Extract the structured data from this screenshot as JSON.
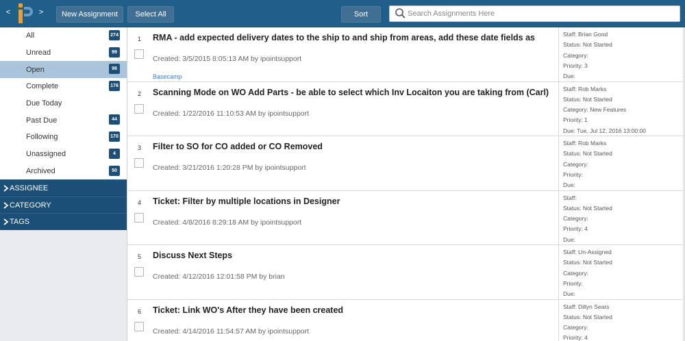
{
  "toolbar": {
    "back": "<",
    "forward": ">",
    "new_assignment": "New Assignment",
    "select_all": "Select All",
    "sort": "Sort",
    "search_placeholder": "Search Assignments Here"
  },
  "colors": {
    "accent": "#1f5f8a",
    "sidebar_dark": "#1c4f77",
    "active": "#aac4dc",
    "link": "#3d7cc9",
    "logo_orange": "#f39c2e"
  },
  "sidebar": {
    "items": [
      {
        "label": "All",
        "count": "274"
      },
      {
        "label": "Unread",
        "count": "99"
      },
      {
        "label": "Open",
        "count": "98",
        "active": true
      },
      {
        "label": "Complete",
        "count": "176"
      },
      {
        "label": "Due Today",
        "count": ""
      },
      {
        "label": "Past Due",
        "count": "44"
      },
      {
        "label": "Following",
        "count": "170"
      },
      {
        "label": "Unassigned",
        "count": "4"
      },
      {
        "label": "Archived",
        "count": "50"
      }
    ],
    "sections": [
      {
        "label": "ASSIGNEE"
      },
      {
        "label": "CATEGORY"
      },
      {
        "label": "TAGS"
      }
    ]
  },
  "assignments": [
    {
      "num": "1",
      "title": "RMA - add expected delivery dates to the ship to and ship from areas, add these date fields as",
      "created": "Created: 3/5/2015 8:05:13 AM by ipointsupport",
      "link": "Basecamp",
      "staff": "Staff: Brian Good",
      "status": "Status: Not Started",
      "category": "Category:",
      "priority": "Priority: 3",
      "due": "Due:"
    },
    {
      "num": "2",
      "title": "Scanning Mode on WO Add Parts - be able to select which Inv Locaiton you are taking from (Carl)",
      "created": "Created: 1/22/2016 11:10:53 AM by ipointsupport",
      "link": "",
      "staff": "Staff: Rob Marks",
      "status": "Status: Not Started",
      "category": "Category: New Features",
      "priority": "Priority: 1",
      "due": "Due: Tue, Jul 12, 2016 13:00:00"
    },
    {
      "num": "3",
      "title": "Filter to SO for CO added or CO Removed",
      "created": "Created: 3/21/2016 1:20:28 PM by ipointsupport",
      "link": "",
      "staff": "Staff: Rob Marks",
      "status": "Status: Not Started",
      "category": "Category:",
      "priority": "Priority:",
      "due": "Due:"
    },
    {
      "num": "4",
      "title": "Ticket: Filter by multiple locations in Designer",
      "created": "Created: 4/8/2016 8:29:18 AM by ipointsupport",
      "link": "",
      "staff": "Staff:",
      "status": "Status: Not Started",
      "category": "Category:",
      "priority": "Priority: 4",
      "due": "Due:"
    },
    {
      "num": "5",
      "title": "Discuss Next Steps",
      "created": "Created: 4/12/2016 12:01:58 PM by brian",
      "link": "",
      "staff": "Staff: Un-Assigned",
      "status": "Status: Not Started",
      "category": "Category:",
      "priority": "Priority:",
      "due": "Due:"
    },
    {
      "num": "6",
      "title": "Ticket: Link WO's After they have been created",
      "created": "Created: 4/14/2016 11:54:57 AM by ipointsupport",
      "link": "",
      "staff": "Staff: Dillyn Sears",
      "status": "Status: Not Started",
      "category": "Category:",
      "priority": "Priority: 4",
      "due": ""
    }
  ]
}
